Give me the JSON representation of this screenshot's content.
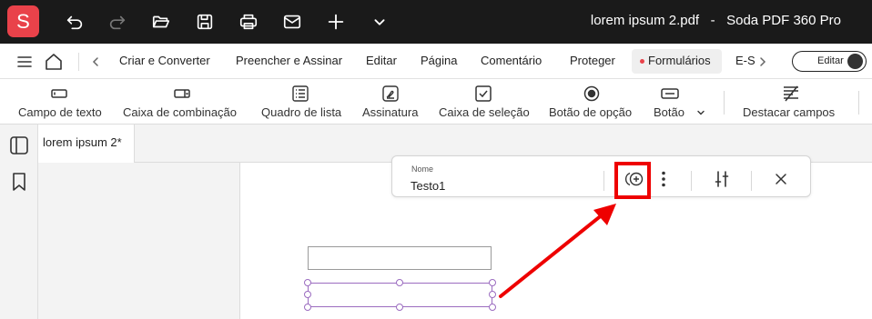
{
  "titlebar": {
    "logo": "S",
    "title": "lorem ipsum 2.pdf   -   Soda PDF 360 Pro",
    "icons": [
      "undo-icon",
      "redo-icon",
      "folder-open-icon",
      "save-icon",
      "print-icon",
      "mail-icon",
      "plus-icon",
      "chevron-down-icon"
    ]
  },
  "menubar": {
    "items": [
      "Criar e Converter",
      "Preencher e Assinar",
      "Editar",
      "Página",
      "Comentário",
      "Proteger",
      "Formulários",
      "E-S"
    ],
    "active": "Formulários",
    "edit_toggle": "Editar"
  },
  "toolbar": {
    "tools": [
      "Campo de texto",
      "Caixa de combinação",
      "Quadro de lista",
      "Assinatura",
      "Caixa de seleção",
      "Botão de opção",
      "Botão",
      "Destacar campos"
    ]
  },
  "document": {
    "tab": "lorem ipsum 2*"
  },
  "field_panel": {
    "name_label": "Nome",
    "name_value": "Testo1"
  },
  "colors": {
    "brand": "#e9424a",
    "titlebar_bg": "#1a1a1a",
    "annotation": "#ee0000",
    "selection": "#9b6cc0"
  }
}
